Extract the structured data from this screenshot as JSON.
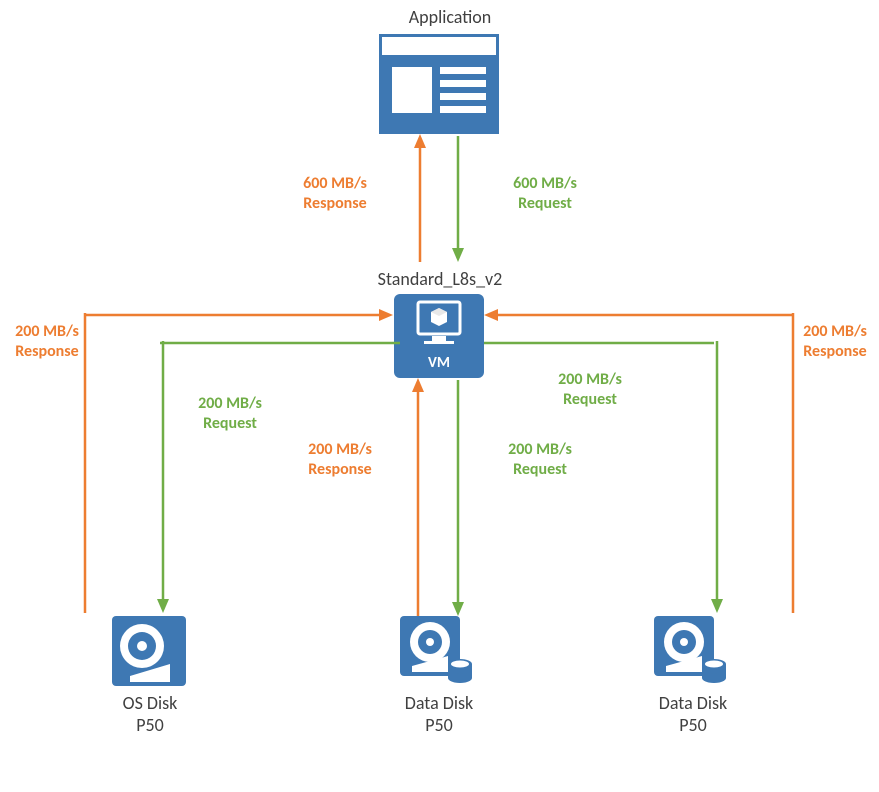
{
  "titles": {
    "application": "Application",
    "vm": "Standard_L8s_v2",
    "vm_badge": "VM",
    "os_disk_l1": "OS Disk",
    "os_disk_l2": "P50",
    "data_disk1_l1": "Data Disk",
    "data_disk1_l2": "P50",
    "data_disk2_l1": "Data Disk",
    "data_disk2_l2": "P50"
  },
  "flows": {
    "app_response_l1": "600 MB/s",
    "app_response_l2": "Response",
    "app_request_l1": "600 MB/s",
    "app_request_l2": "Request",
    "os_resp_l1": "200 MB/s",
    "os_resp_l2": "Response",
    "os_req_l1": "200 MB/s",
    "os_req_l2": "Request",
    "d1_resp_l1": "200 MB/s",
    "d1_resp_l2": "Response",
    "d1_req_l1": "200 MB/s",
    "d1_req_l2": "Request",
    "d2_resp_l1": "200 MB/s",
    "d2_resp_l2": "Response",
    "d2_req_l1": "200 MB/s",
    "d2_req_l2": "Request"
  },
  "colors": {
    "blue": "#3E78B3",
    "green": "#70AD47",
    "orange": "#ED7D31"
  }
}
